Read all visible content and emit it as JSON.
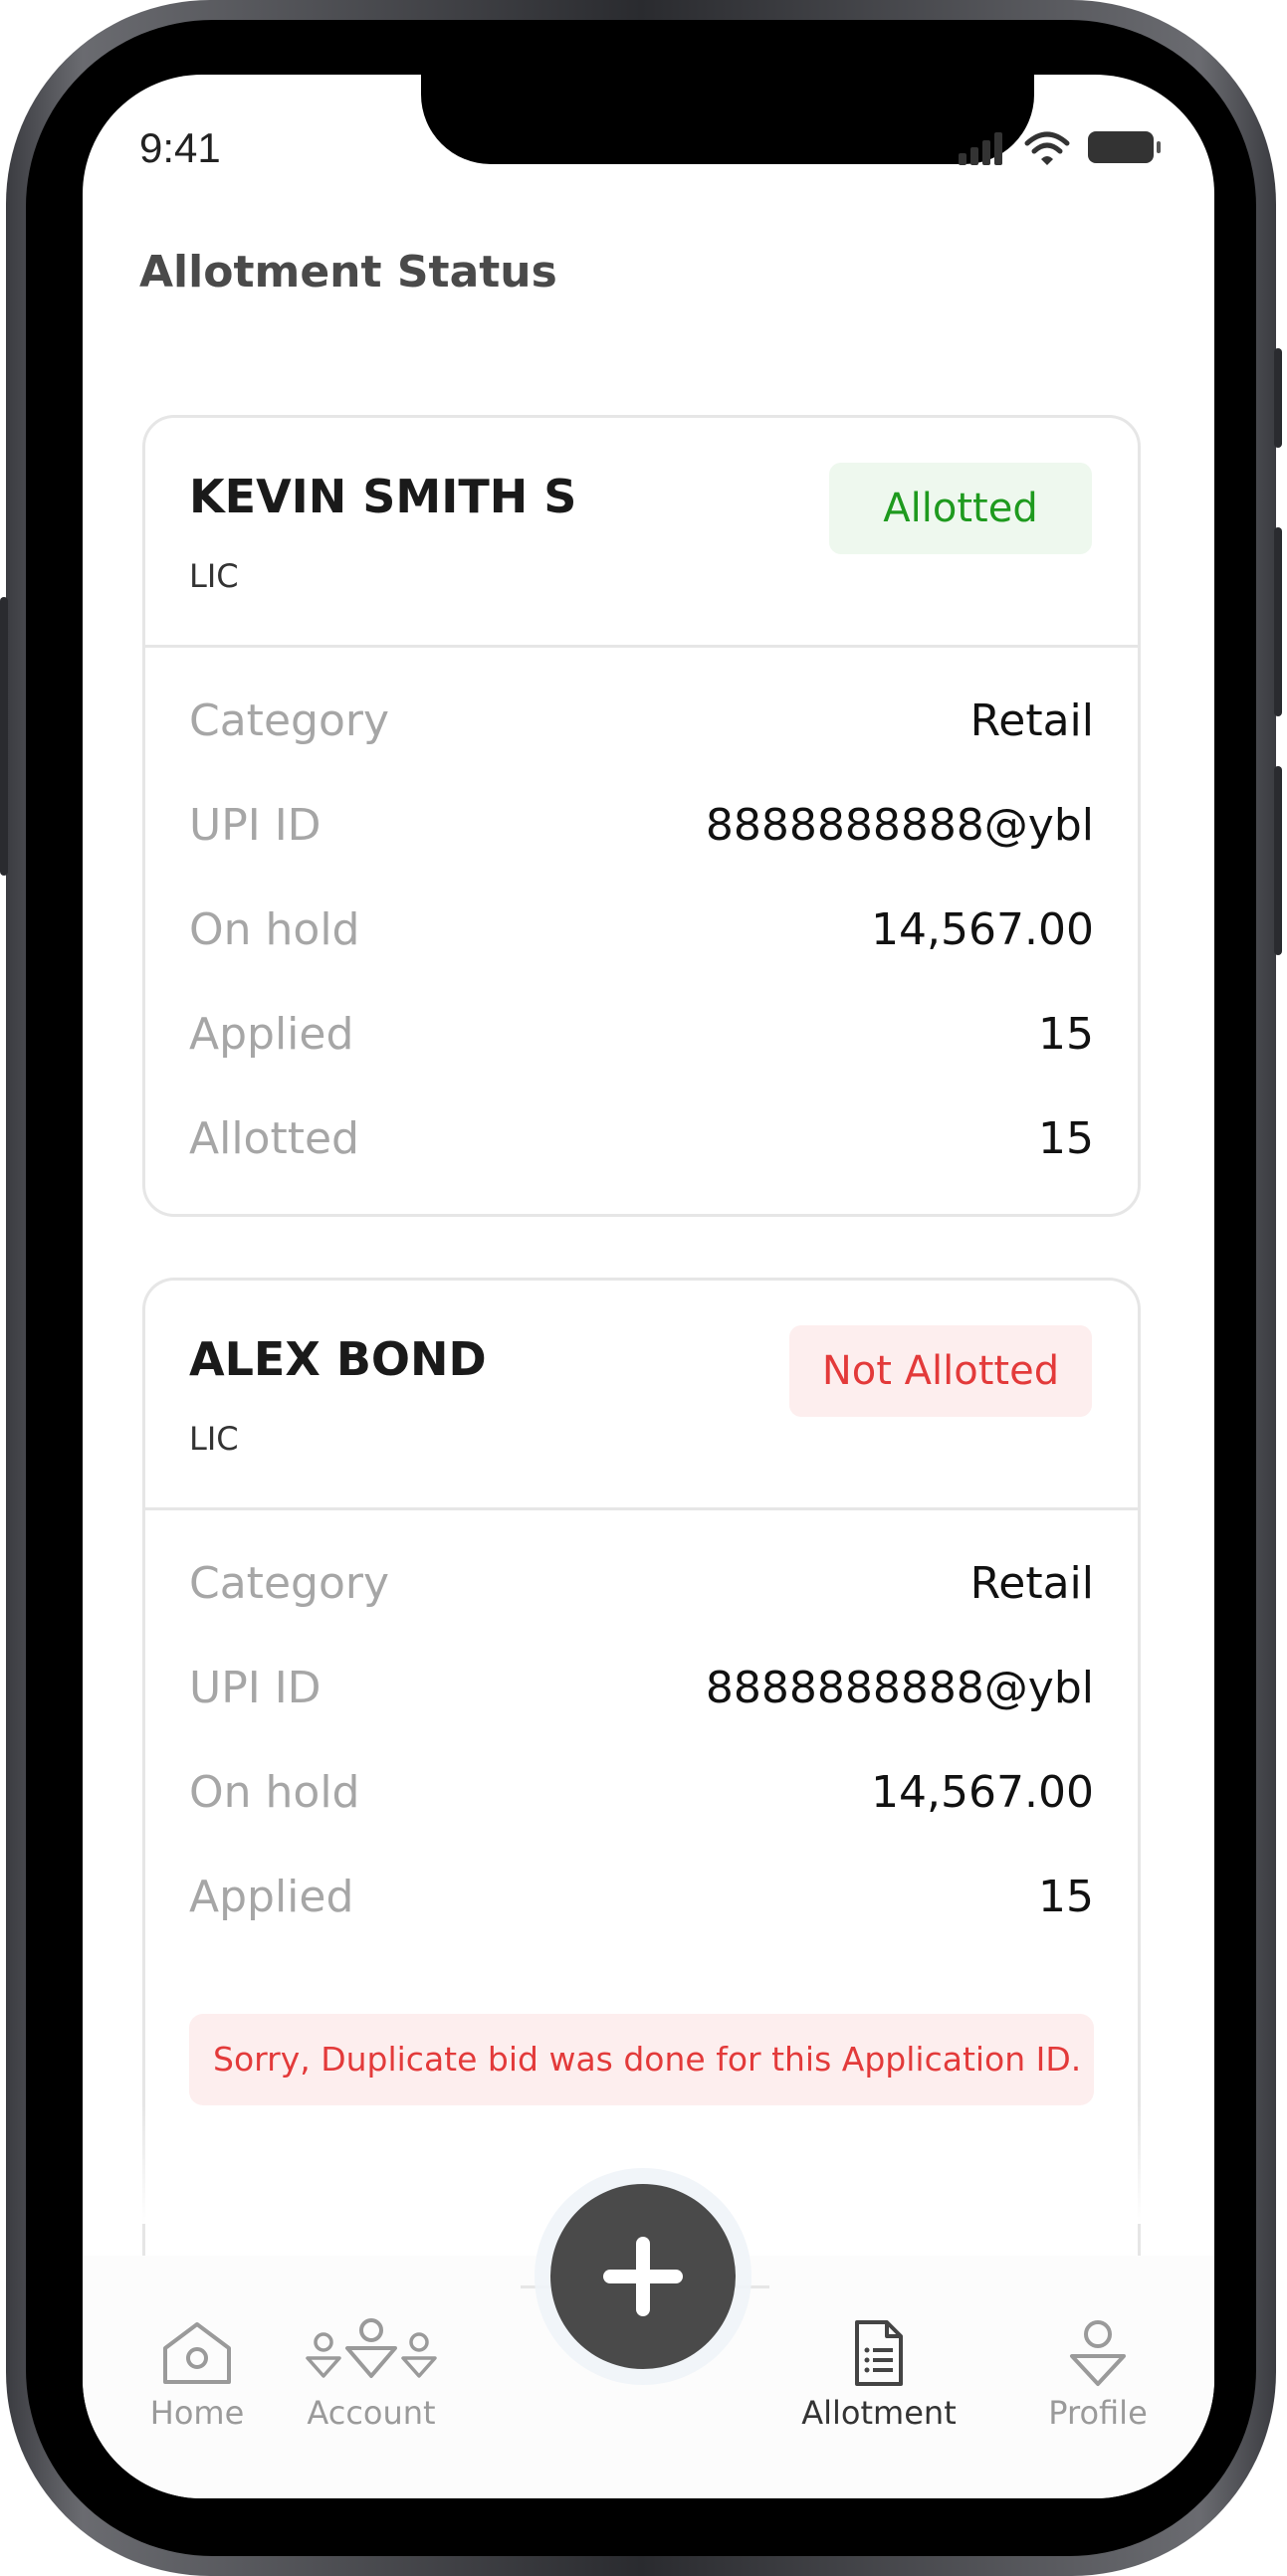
{
  "status_bar": {
    "time": "9:41"
  },
  "page": {
    "title": "Allotment Status"
  },
  "cards": [
    {
      "name": "KEVIN SMITH S",
      "sub": "LIC",
      "status": "Allotted",
      "rows": [
        {
          "label": "Category",
          "value": "Retail"
        },
        {
          "label": "UPI ID",
          "value": "8888888888@ybl"
        },
        {
          "label": "On hold",
          "value": "14,567.00"
        },
        {
          "label": "Applied",
          "value": "15"
        },
        {
          "label": "Allotted",
          "value": "15"
        }
      ]
    },
    {
      "name": "ALEX BOND",
      "sub": "LIC",
      "status": "Not Allotted",
      "rows": [
        {
          "label": "Category",
          "value": "Retail"
        },
        {
          "label": "UPI ID",
          "value": "8888888888@ybl"
        },
        {
          "label": "On hold",
          "value": "14,567.00"
        },
        {
          "label": "Applied",
          "value": "15"
        }
      ],
      "message": "Sorry, Duplicate bid was done for this Application ID."
    }
  ],
  "nav": {
    "home": "Home",
    "account": "Account",
    "allotment": "Allotment",
    "profile": "Profile",
    "active": "allotment",
    "fab_icon": "plus-icon"
  },
  "colors": {
    "allotted_text": "#1e9a1e",
    "allotted_bg": "#eef8ee",
    "not_allotted_text": "#e33a3a",
    "not_allotted_bg": "#fdeeee",
    "fab": "#4a4a4a"
  }
}
